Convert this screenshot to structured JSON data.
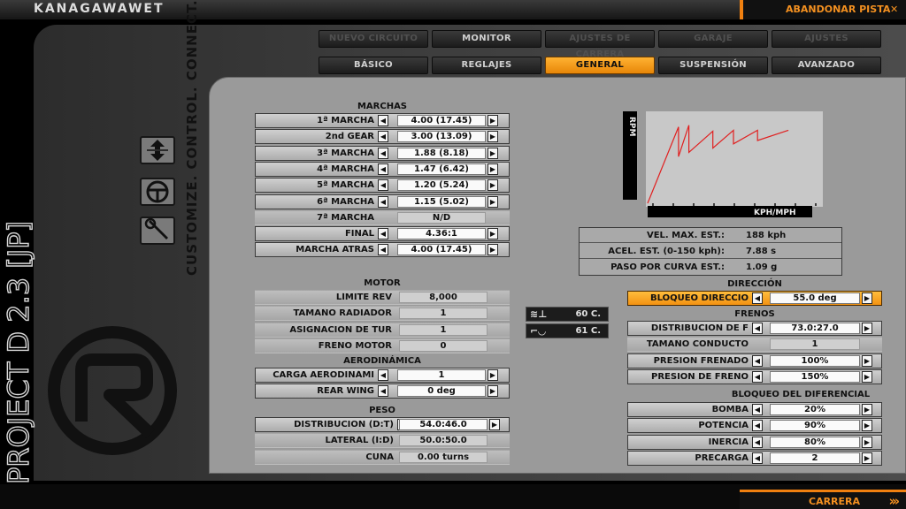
{
  "header": {
    "logo": "KANAGAWAWET",
    "abandon": "ABANDONAR PISTA"
  },
  "footer": {
    "carrera": "CARRERA"
  },
  "brand": {
    "tagline": "CUSTOMIZE. CONTROL. CONNECT.",
    "game": "PROJECT D 2.3 [JP]"
  },
  "nav_top": [
    {
      "label": "NUEVO CIRCUITO",
      "state": "dim"
    },
    {
      "label": "MONITOR",
      "state": "normal"
    },
    {
      "label": "AJUSTES DE CARRERA",
      "state": "dim"
    },
    {
      "label": "GARAJE",
      "state": "dim"
    },
    {
      "label": "AJUSTES",
      "state": "dim"
    }
  ],
  "nav_sub": [
    {
      "label": "BÁSICO",
      "state": "normal"
    },
    {
      "label": "REGLAJES",
      "state": "normal"
    },
    {
      "label": "GENERAL",
      "state": "active"
    },
    {
      "label": "SUSPENSIÓN",
      "state": "normal"
    },
    {
      "label": "AVANZADO",
      "state": "normal"
    }
  ],
  "gears": {
    "title": "MARCHAS",
    "rows": [
      {
        "label": "1ª MARCHA",
        "value": "4.00 (17.45)",
        "arrows": true
      },
      {
        "label": "2nd GEAR",
        "value": "3.00 (13.09)",
        "arrows": true
      },
      {
        "label": "3ª MARCHA",
        "value": "1.88 (8.18)",
        "arrows": true
      },
      {
        "label": "4ª MARCHA",
        "value": "1.47 (6.42)",
        "arrows": true
      },
      {
        "label": "5ª MARCHA",
        "value": "1.20 (5.24)",
        "arrows": true
      },
      {
        "label": "6ª MARCHA",
        "value": "1.15 (5.02)",
        "arrows": true
      },
      {
        "label": "7ª MARCHA",
        "value": "N/D",
        "arrows": false
      },
      {
        "label": "FINAL",
        "value": "4.36:1",
        "arrows": true
      },
      {
        "label": "MARCHA ATRÁS",
        "value": "4.00 (17.45)",
        "arrows": true
      }
    ]
  },
  "graph": {
    "ylabel": "RPM",
    "xlabel": "KPH/MPH"
  },
  "chart_data": {
    "type": "line",
    "ylabel": "RPM",
    "xlabel": "KPH/MPH",
    "ticks_shown": false,
    "series": [
      {
        "x": [
          0,
          0.18,
          0.18,
          0.24,
          0.24,
          0.38,
          0.38,
          0.5,
          0.5,
          0.64,
          0.64,
          0.82
        ],
        "y": [
          0,
          0.9,
          0.55,
          0.92,
          0.6,
          0.85,
          0.65,
          0.86,
          0.7,
          0.86,
          0.74,
          0.86
        ]
      }
    ]
  },
  "stats": [
    {
      "label": "VEL. MAX. EST.:",
      "value": "188 kph"
    },
    {
      "label": "ACEL. EST. (0-150 kph):",
      "value": "7.88 s"
    },
    {
      "label": "PASO POR CURVA EST.:",
      "value": "1.09 g"
    }
  ],
  "motor": {
    "title": "MOTOR",
    "rows": [
      {
        "label": "LÍMITE REV",
        "value": "8,000",
        "arrows": false
      },
      {
        "label": "TAMAÑO RADIADOR",
        "value": "1",
        "arrows": false
      },
      {
        "label": "ASIGNACIÓN DE TUR",
        "value": "1",
        "arrows": false
      },
      {
        "label": "FRENO MOTOR",
        "value": "0",
        "arrows": false
      }
    ]
  },
  "temps": [
    {
      "icon": "water-temp-icon",
      "value": "60 C."
    },
    {
      "icon": "oil-temp-icon",
      "value": "61 C."
    }
  ],
  "aero": {
    "title": "AERODINÁMICA",
    "rows": [
      {
        "label": "CARGA AERODINÁMI",
        "value": "1",
        "arrows": true
      },
      {
        "label": "REAR WING",
        "value": "0 deg",
        "arrows": true
      }
    ]
  },
  "weight": {
    "title": "PESO",
    "rows": [
      {
        "label": "DISTRIBUCIÓN (D:T)",
        "value": "54.0:46.0",
        "arrows": true
      },
      {
        "label": "LATERAL (I:D)",
        "value": "50.0:50.0",
        "arrows": false
      },
      {
        "label": "CUÑA",
        "value": "0.00 turns",
        "arrows": false
      }
    ]
  },
  "steering": {
    "title": "DIRECCIÓN",
    "rows": [
      {
        "label": "BLOQUEO DIRECCIÓ",
        "value": "55.0 deg",
        "arrows": true
      }
    ]
  },
  "brakes": {
    "title": "FRENOS",
    "rows": [
      {
        "label": "DISTRIBUCIÓN DE F",
        "value": "73.0:27.0",
        "arrows": true
      },
      {
        "label": "TAMAÑO CONDUCTO",
        "value": "1",
        "arrows": false
      },
      {
        "label": "PRESIÓN FRENADO",
        "value": "100%",
        "arrows": true
      },
      {
        "label": "PRESIÓN DE FRENO",
        "value": "150%",
        "arrows": true
      }
    ]
  },
  "diff": {
    "title": "BLOQUEO DEL DIFERENCIAL",
    "rows": [
      {
        "label": "BOMBA",
        "value": "20%",
        "arrows": true
      },
      {
        "label": "POTENCIA",
        "value": "90%",
        "arrows": true
      },
      {
        "label": "INERCIA",
        "value": "80%",
        "arrows": true
      },
      {
        "label": "PRECARGA",
        "value": "2",
        "arrows": true
      }
    ]
  },
  "colors": {
    "accent": "#f39020",
    "highlight": "#ffb232"
  }
}
